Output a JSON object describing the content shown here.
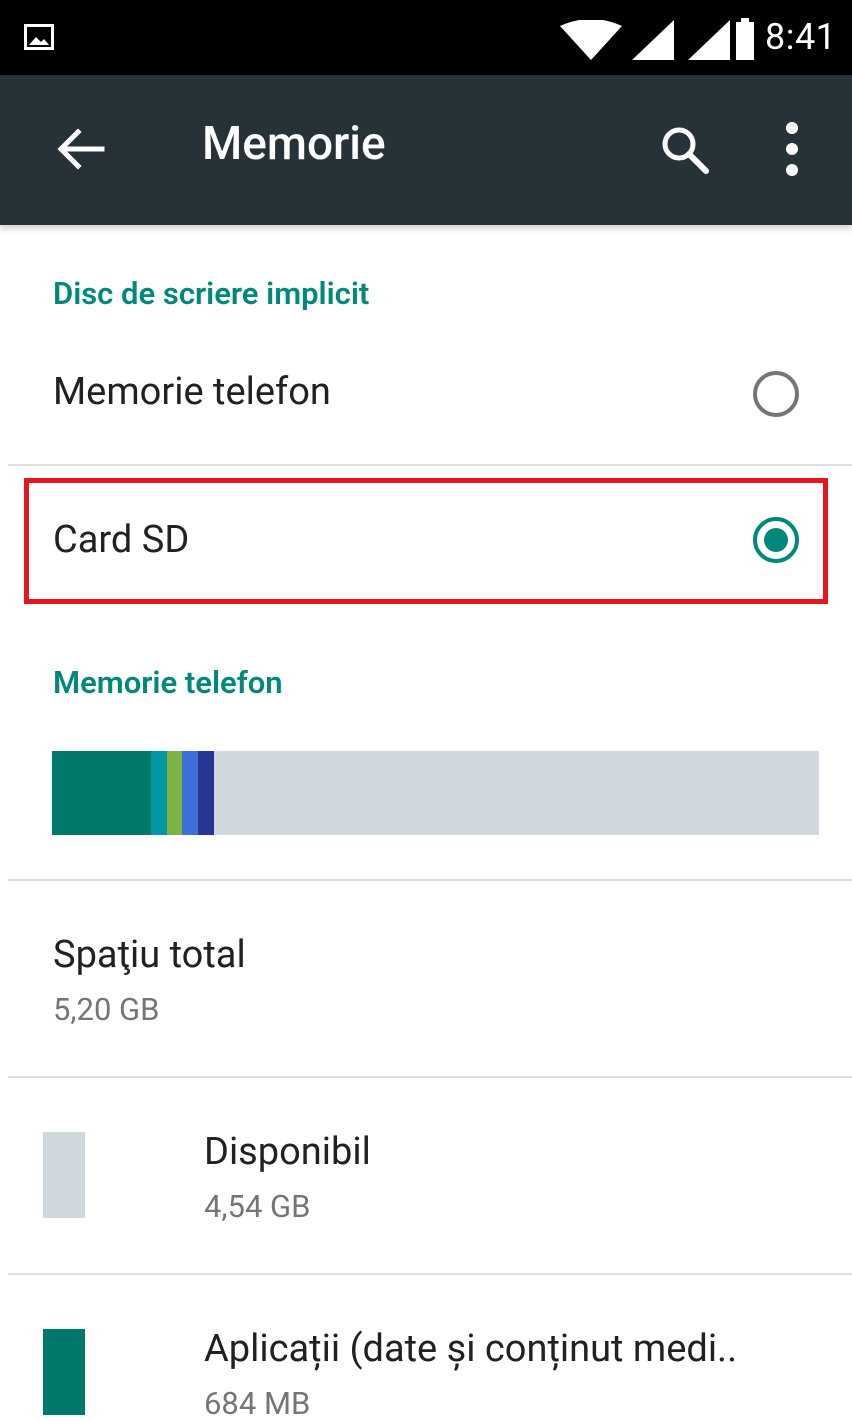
{
  "status_bar": {
    "time": "8:41",
    "icons": [
      "image-notification-icon",
      "wifi-icon",
      "signal-icon",
      "signal-icon",
      "battery-icon"
    ]
  },
  "toolbar": {
    "title": "Memorie",
    "icons": [
      "back-arrow-icon",
      "search-icon",
      "more-vert-icon"
    ]
  },
  "default_disk": {
    "header": "Disc de scriere implicit",
    "options": [
      {
        "label": "Memorie telefon",
        "selected": false
      },
      {
        "label": "Card SD",
        "selected": true
      }
    ]
  },
  "phone_memory": {
    "header": "Memorie telefon",
    "usage_segments": [
      {
        "color": "#00796B",
        "fraction": 0.1291
      },
      {
        "color": "#0097A7",
        "fraction": 0.0209
      },
      {
        "color": "#7CB342",
        "fraction": 0.0196
      },
      {
        "color": "#3F6FD8",
        "fraction": 0.0209
      },
      {
        "color": "#283593",
        "fraction": 0.0209
      }
    ],
    "free_color": "#CFD8DC",
    "total": {
      "label": "Spaţiu total",
      "value": "5,20 GB"
    },
    "items": [
      {
        "label": "Disponibil",
        "value": "4,54 GB",
        "color": "#CFD8DC"
      },
      {
        "label": "Aplicații (date și conținut medi..",
        "value": "684 MB",
        "color": "#00796B"
      }
    ]
  },
  "colors": {
    "accent": "#00897B",
    "toolbar": "#263238",
    "status_bar": "#000000",
    "highlight": "#E5161D"
  }
}
